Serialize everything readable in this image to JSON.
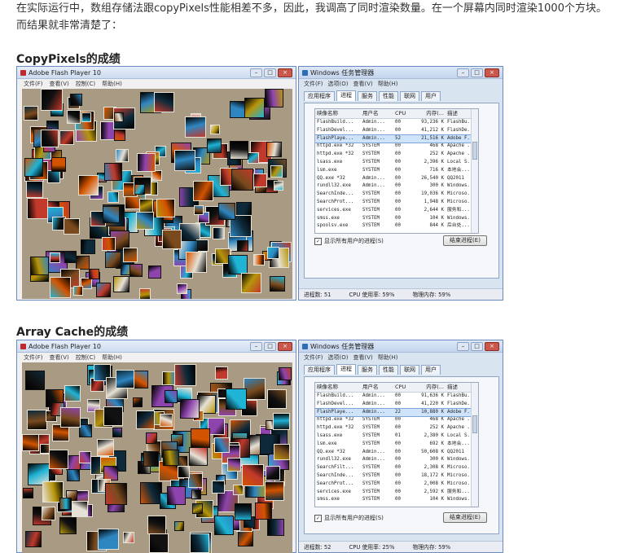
{
  "intro": "在实际运行中，数组存储法跟copyPixels性能相差不多，因此，我调高了同时渲染数量。在一个屏幕内同时渲染1000个方块。而结果就非常清楚了：",
  "sections": [
    {
      "title": "CopyPixels的成绩",
      "flash": {
        "title": "Adobe Flash Player 10",
        "menus": [
          "文件(F)",
          "查看(V)",
          "控制(C)",
          "帮助(H)"
        ]
      },
      "taskmgr": {
        "title": "Windows 任务管理器",
        "menus": [
          "文件(F)",
          "选项(O)",
          "查看(V)",
          "帮助(H)"
        ],
        "tabs": [
          "应用程序",
          "进程",
          "服务",
          "性能",
          "联网",
          "用户"
        ],
        "active_tab": 1,
        "columns": [
          "映像名称",
          "用户名",
          "CPU",
          "内存(...",
          "描述"
        ],
        "rows": [
          [
            "FlashBuild...",
            "Admin...",
            "00",
            "93,236 K",
            "FlashBu..."
          ],
          [
            "FlashDevel...",
            "Admin...",
            "00",
            "41,212 K",
            "FlashDe..."
          ],
          [
            "FlashPlaye...",
            "Admin...",
            "52",
            "21,516 K",
            "Adobe F..."
          ],
          [
            "httpd.exe *32",
            "SYSTEM",
            "00",
            "468 K",
            "Apache ..."
          ],
          [
            "httpd.exe *32",
            "SYSTEM",
            "00",
            "252 K",
            "Apache ..."
          ],
          [
            "lsass.exe",
            "SYSTEM",
            "00",
            "2,396 K",
            "Local S..."
          ],
          [
            "lsm.exe",
            "SYSTEM",
            "00",
            "716 K",
            "本地会..."
          ],
          [
            "QQ.exe *32",
            "Admin...",
            "00",
            "26,540 K",
            "QQ2011"
          ],
          [
            "rundll32.exe",
            "Admin...",
            "00",
            "300 K",
            "Windows..."
          ],
          [
            "SearchInde...",
            "SYSTEM",
            "00",
            "19,036 K",
            "Microso..."
          ],
          [
            "SearchProt...",
            "SYSTEM",
            "00",
            "1,948 K",
            "Microso..."
          ],
          [
            "services.exe",
            "SYSTEM",
            "00",
            "2,644 K",
            "服务和..."
          ],
          [
            "smss.exe",
            "SYSTEM",
            "00",
            "104 K",
            "Windows..."
          ],
          [
            "spoolsv.exe",
            "SYSTEM",
            "00",
            "844 K",
            "后台处..."
          ]
        ],
        "selected_row": 2,
        "show_all_label": "显示所有用户的进程(S)",
        "end_process": "结束进程(E)",
        "status_procs": "进程数: 51",
        "status_cpu": "CPU 使用率: 59%",
        "status_mem": "物理内存: 59%"
      }
    },
    {
      "title": "Array Cache的成绩",
      "flash": {
        "title": "Adobe Flash Player 10",
        "menus": [
          "文件(F)",
          "查看(V)",
          "控制(C)",
          "帮助(H)"
        ]
      },
      "taskmgr": {
        "title": "Windows 任务管理器",
        "menus": [
          "文件(F)",
          "选项(O)",
          "查看(V)",
          "帮助(H)"
        ],
        "tabs": [
          "应用程序",
          "进程",
          "服务",
          "性能",
          "联网",
          "用户"
        ],
        "active_tab": 1,
        "columns": [
          "映像名称",
          "用户名",
          "CPU",
          "内存(...",
          "描述"
        ],
        "rows": [
          [
            "FlashBuild...",
            "Admin...",
            "00",
            "91,636 K",
            "FlashBu..."
          ],
          [
            "FlashDevel...",
            "Admin...",
            "00",
            "41,220 K",
            "FlashDe..."
          ],
          [
            "FlashPlaye...",
            "Admin...",
            "22",
            "10,880 K",
            "Adobe F..."
          ],
          [
            "httpd.exe *32",
            "SYSTEM",
            "00",
            "468 K",
            "Apache ..."
          ],
          [
            "httpd.exe *32",
            "SYSTEM",
            "00",
            "252 K",
            "Apache ..."
          ],
          [
            "lsass.exe",
            "SYSTEM",
            "01",
            "2,380 K",
            "Local S..."
          ],
          [
            "lsm.exe",
            "SYSTEM",
            "00",
            "692 K",
            "本地会..."
          ],
          [
            "QQ.exe *32",
            "Admin...",
            "00",
            "50,608 K",
            "QQ2011"
          ],
          [
            "rundll32.exe",
            "Admin...",
            "00",
            "300 K",
            "Windows..."
          ],
          [
            "SearchFilt...",
            "SYSTEM",
            "00",
            "2,308 K",
            "Microso..."
          ],
          [
            "SearchInde...",
            "SYSTEM",
            "00",
            "18,172 K",
            "Microso..."
          ],
          [
            "SearchProt...",
            "SYSTEM",
            "00",
            "2,008 K",
            "Microso..."
          ],
          [
            "services.exe",
            "SYSTEM",
            "00",
            "2,592 K",
            "服务和..."
          ],
          [
            "smss.exe",
            "SYSTEM",
            "00",
            "104 K",
            "Windows..."
          ]
        ],
        "selected_row": 2,
        "show_all_label": "显示所有用户的进程(S)",
        "end_process": "结束进程(E)",
        "status_procs": "进程数: 52",
        "status_cpu": "CPU 使用率: 25%",
        "status_mem": "物理内存: 59%"
      }
    }
  ],
  "colors": {
    "tile_palette": [
      "#0e2a3a",
      "#1fb3d6",
      "#7a4a1e",
      "#e7e2d6",
      "#111111",
      "#c0392b",
      "#8e44ad",
      "#2e86c1",
      "#b7950b",
      "#d35400"
    ],
    "canvas_bg": "#a99a83"
  }
}
